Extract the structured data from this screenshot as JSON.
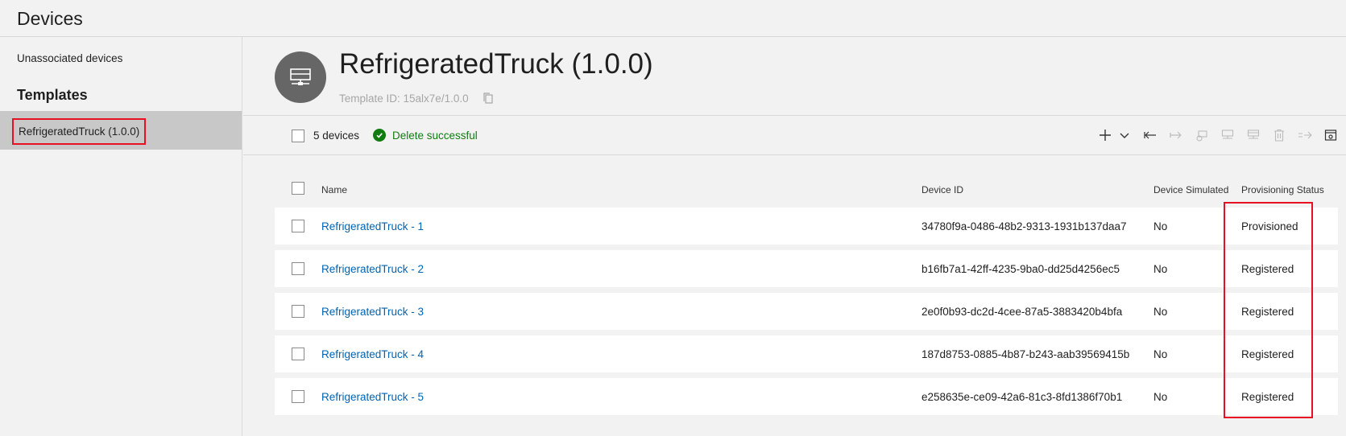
{
  "app": {
    "title": "Devices"
  },
  "sidebar": {
    "unassociated_label": "Unassociated devices",
    "templates_heading": "Templates",
    "template_item": "RefrigeratedTruck (1.0.0)"
  },
  "header": {
    "title": "RefrigeratedTruck (1.0.0)",
    "template_id": "Template ID: 15alx7e/1.0.0"
  },
  "toolbar": {
    "device_count": "5 devices",
    "status_message": "Delete successful",
    "icons": [
      "plus-icon",
      "chevron-down-icon",
      "arrow-left-icon",
      "arrow-right-icon",
      "block-icon",
      "device-icon",
      "device-icon",
      "delete-icon",
      "migrate-icon",
      "column-options-icon"
    ]
  },
  "table": {
    "headers": {
      "name": "Name",
      "device_id": "Device ID",
      "simulated": "Device Simulated",
      "provisioning": "Provisioning Status"
    },
    "rows": [
      {
        "name": "RefrigeratedTruck - 1",
        "device_id": "34780f9a-0486-48b2-9313-1931b137daa7",
        "simulated": "No",
        "provisioning": "Provisioned"
      },
      {
        "name": "RefrigeratedTruck - 2",
        "device_id": "b16fb7a1-42ff-4235-9ba0-dd25d4256ec5",
        "simulated": "No",
        "provisioning": "Registered"
      },
      {
        "name": "RefrigeratedTruck - 3",
        "device_id": "2e0f0b93-dc2d-4cee-87a5-3883420b4bfa",
        "simulated": "No",
        "provisioning": "Registered"
      },
      {
        "name": "RefrigeratedTruck - 4",
        "device_id": "187d8753-0885-4b87-b243-aab39569415b",
        "simulated": "No",
        "provisioning": "Registered"
      },
      {
        "name": "RefrigeratedTruck - 5",
        "device_id": "e258635e-ce09-42a6-81c3-8fd1386f70b1",
        "simulated": "No",
        "provisioning": "Registered"
      }
    ]
  },
  "colors": {
    "accent_link": "#0063b1",
    "success": "#107c10",
    "highlight": "#e81123",
    "avatar": "#666666"
  }
}
